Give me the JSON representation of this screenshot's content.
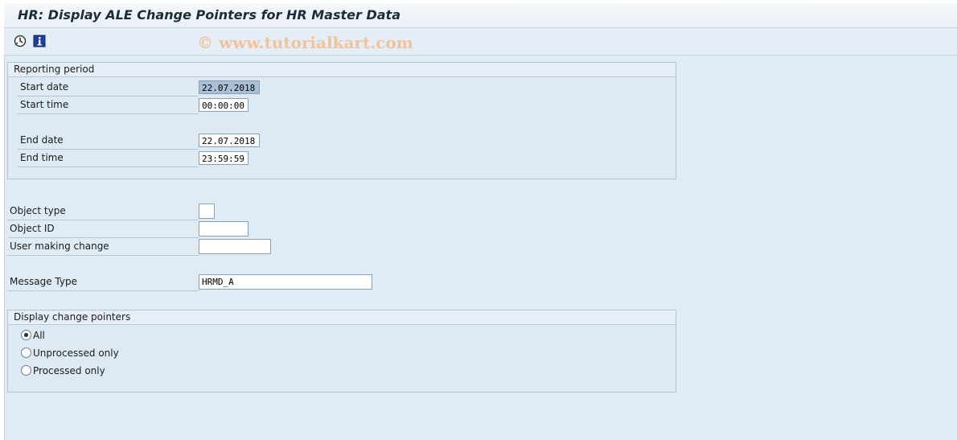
{
  "window": {
    "title": "HR: Display ALE Change Pointers for HR Master Data"
  },
  "toolbar": {
    "execute_icon": "execute-clock-icon",
    "info_icon": "info-icon",
    "watermark": "© www.tutorialkart.com"
  },
  "reporting_period": {
    "title": "Reporting period",
    "start_date_label": "Start date",
    "start_date_value": "22.07.2018",
    "start_time_label": "Start time",
    "start_time_value": "00:00:00",
    "end_date_label": "End date",
    "end_date_value": "22.07.2018",
    "end_time_label": "End time",
    "end_time_value": "23:59:59"
  },
  "selection": {
    "object_type_label": "Object type",
    "object_type_value": "",
    "object_id_label": "Object ID",
    "object_id_value": "",
    "user_label": "User making change",
    "user_value": "",
    "message_type_label": "Message Type",
    "message_type_value": "HRMD_A"
  },
  "display_pointers": {
    "title": "Display change pointers",
    "options": [
      {
        "label": "All",
        "selected": true
      },
      {
        "label": "Unprocessed only",
        "selected": false
      },
      {
        "label": "Processed only",
        "selected": false
      }
    ]
  },
  "colors": {
    "background": "#dfebf5",
    "field_selected": "#a9bfd5",
    "watermark": "#f0c39a"
  }
}
